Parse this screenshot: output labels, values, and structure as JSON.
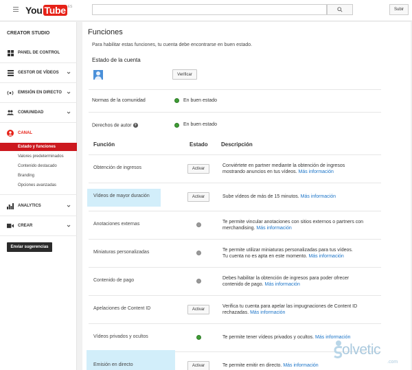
{
  "header": {
    "logo_you": "You",
    "logo_tube": "Tube",
    "logo_region": "ES",
    "search_placeholder": "",
    "upload_label": "Subir"
  },
  "sidebar": {
    "title": "CREATOR STUDIO",
    "items": [
      {
        "label": "PANEL DE CONTROL",
        "icon": "dashboard-icon",
        "chevron": false
      },
      {
        "label": "GESTOR DE VÍDEOS",
        "icon": "video-manager-icon",
        "chevron": true
      },
      {
        "label": "EMISIÓN EN DIRECTO",
        "icon": "live-stream-icon",
        "chevron": true
      },
      {
        "label": "COMUNIDAD",
        "icon": "community-icon",
        "chevron": true
      },
      {
        "label": "CANAL",
        "icon": "channel-icon",
        "chevron": false
      },
      {
        "label": "ANALYTICS",
        "icon": "analytics-icon",
        "chevron": true
      },
      {
        "label": "CREAR",
        "icon": "create-icon",
        "chevron": true
      }
    ],
    "channel_subitems": [
      {
        "label": "Estado y funciones",
        "active": true
      },
      {
        "label": "Valores predeterminados",
        "active": false
      },
      {
        "label": "Contenido destacado",
        "active": false
      },
      {
        "label": "Branding",
        "active": false
      },
      {
        "label": "Opciones avanzadas",
        "active": false
      }
    ],
    "feedback_label": "Enviar sugerencias"
  },
  "main": {
    "title": "Funciones",
    "description": "Para habilitar estas funciones, tu cuenta debe encontrarse en buen estado.",
    "account_status_title": "Estado de la cuenta",
    "verify_label": "Verificar",
    "community_label": "Normas de la comunidad",
    "community_status": "En buen estado",
    "copyright_label": "Derechos de autor",
    "copyright_status": "En buen estado",
    "help_glyph": "?",
    "columns": {
      "feature": "Función",
      "status": "Estado",
      "description": "Descripción"
    },
    "link_text": "Más información",
    "features": [
      {
        "name": "Obtención de ingresos",
        "status": "button",
        "button": "Activar",
        "desc1": "Conviértete en partner mediante la obtención de ingresos",
        "desc2": "mostrando anuncios en tus vídeos.",
        "link": true,
        "highlight": false
      },
      {
        "name": "Vídeos de mayor duración",
        "status": "button",
        "button": "Activar",
        "desc1": "Sube vídeos de más de 15 minutos.",
        "desc2": "",
        "link": true,
        "highlight": true
      },
      {
        "name": "Anotaciones externas",
        "status": "gray",
        "desc1": "Te permite vincular anotaciones con sitios externos o partners con",
        "desc2": "merchandising.",
        "link": true,
        "highlight": false
      },
      {
        "name": "Miniaturas personalizadas",
        "status": "gray",
        "desc1": "Te permite utilizar miniaturas personalizadas para tus vídeos.",
        "desc2": "Tu cuenta no es apta en este momento.",
        "link": true,
        "highlight": false
      },
      {
        "name": "Contenido de pago",
        "status": "gray",
        "desc1": "Debes habilitar la obtención de ingresos para poder ofrecer",
        "desc2": "contenido de pago.",
        "link": true,
        "highlight": false
      },
      {
        "name": "Apelaciones de Content ID",
        "status": "button",
        "button": "Activar",
        "desc1": "Verifica tu cuenta para apelar las impugnaciones de Content ID",
        "desc2": "rechazadas.",
        "link": true,
        "highlight": false
      },
      {
        "name": "Vídeos privados y ocultos",
        "status": "green",
        "desc1": "Te permite tener vídeos privados y ocultos.",
        "desc2": "",
        "link": true,
        "highlight": false
      },
      {
        "name": "Emisión en directo",
        "status": "button",
        "button": "Activar",
        "desc1": "Te permite emitir en directo.",
        "desc2": "",
        "link": true,
        "highlight": true
      }
    ]
  },
  "watermark": {
    "text": "olvetic",
    "suffix": ".com"
  },
  "colors": {
    "brand_red": "#e62117",
    "active_red": "#cc181e",
    "link_blue": "#1a73c7",
    "ok_green": "#3f9c35",
    "highlight": "#d2eefa"
  }
}
